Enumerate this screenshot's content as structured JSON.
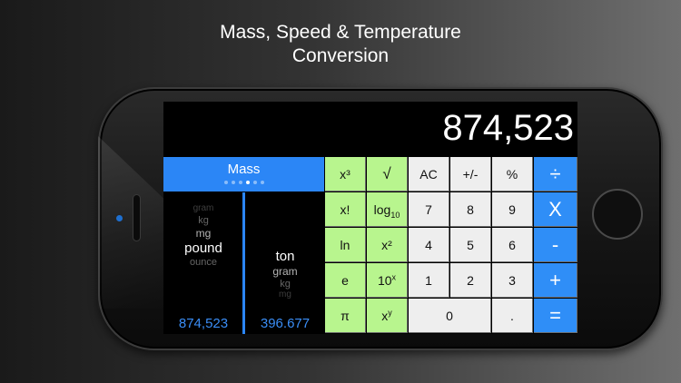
{
  "headline": {
    "line1": "Mass, Speed & Temperature",
    "line2": "Conversion"
  },
  "display": {
    "value": "874,523"
  },
  "converter": {
    "category": "Mass",
    "page_dots": 6,
    "active_dot": 3,
    "left_wheel": {
      "above": [
        "gram",
        "kg",
        "mg"
      ],
      "selected": "pound",
      "below": [
        "ounce"
      ],
      "value": "874,523"
    },
    "right_wheel": {
      "above": [],
      "selected": "ton",
      "below": [
        "gram",
        "kg",
        "mg"
      ],
      "value": "396.677"
    }
  },
  "keypad": {
    "row1": [
      "x³",
      "√",
      "AC",
      "+/-",
      "%",
      "÷"
    ],
    "row2": [
      "x!",
      "log",
      "7",
      "8",
      "9",
      "X"
    ],
    "row2_log_sub": "10",
    "row3": [
      "ln",
      "x²",
      "4",
      "5",
      "6",
      "-"
    ],
    "row4": [
      "e",
      "10",
      "1",
      "2",
      "3",
      "+"
    ],
    "row4_10_sup": "x",
    "row5": [
      "π",
      "x",
      "0",
      ".",
      "="
    ],
    "row5_x_sup": "y"
  },
  "colors": {
    "accent_blue": "#2f8ef7",
    "function_key_green": "#b8f58e",
    "digit_key_white": "#eeeeee",
    "display_bg": "#000000"
  }
}
